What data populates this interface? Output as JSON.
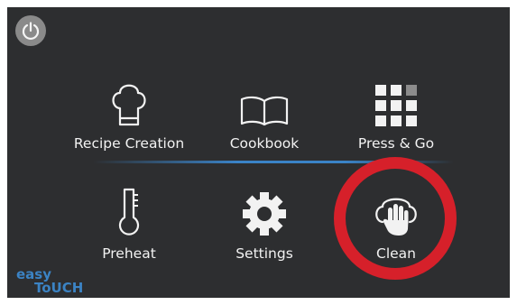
{
  "icons": {
    "power": "power-icon",
    "recipe_creation": "chef-hat-icon",
    "cookbook": "open-book-icon",
    "press_and_go": "grid-icon",
    "preheat": "thermometer-icon",
    "settings": "gear-icon",
    "clean": "hand-on-hat-icon"
  },
  "menu": {
    "recipe_creation": "Recipe Creation",
    "cookbook": "Cookbook",
    "press_and_go": "Press & Go",
    "preheat": "Preheat",
    "settings": "Settings",
    "clean": "Clean"
  },
  "logo": {
    "line1": "easy",
    "line2": "ToUCH"
  },
  "colors": {
    "background": "#2d2e30",
    "icon": "#f2f2f2",
    "accent_blue": "#3a83c7",
    "highlight_red": "#d6202a",
    "power_button": "#8a8a8a"
  }
}
